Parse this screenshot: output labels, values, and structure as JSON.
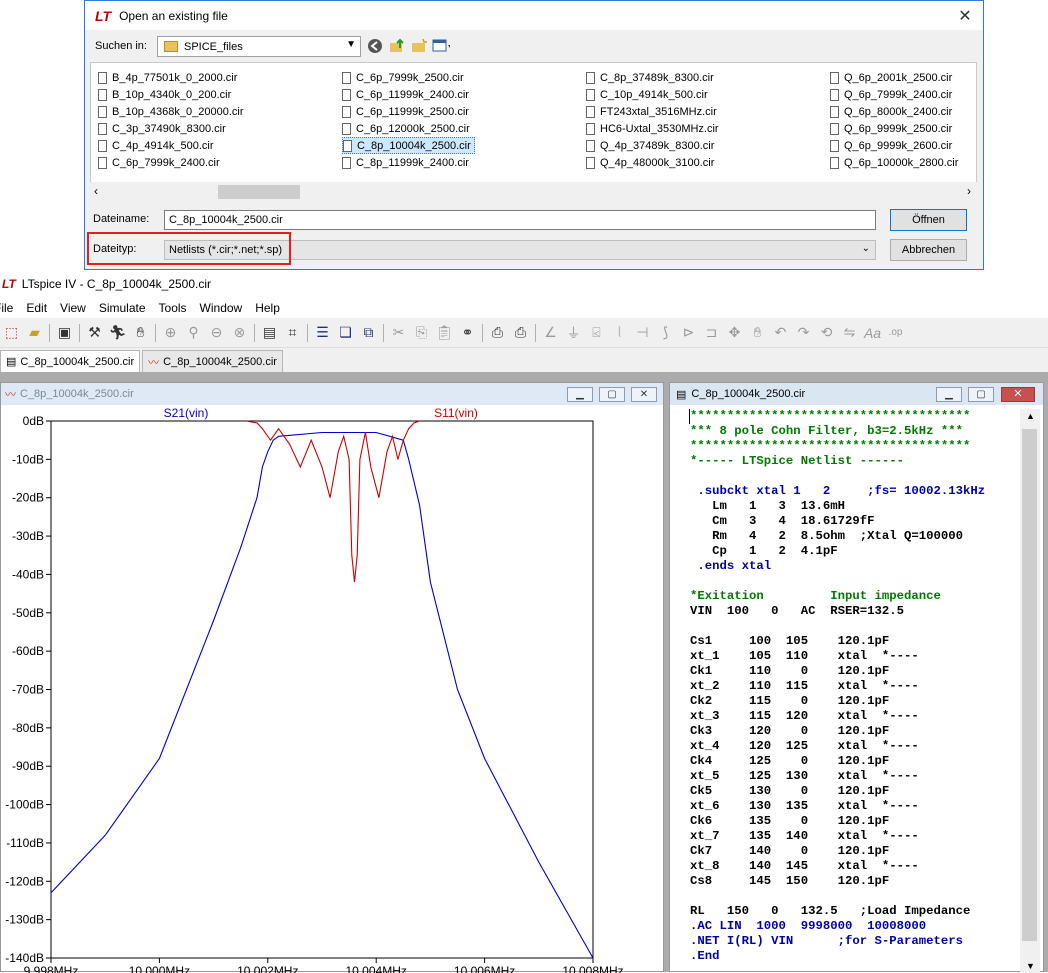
{
  "dialog": {
    "title": "Open an existing file",
    "look_in_label": "Suchen in:",
    "look_in_value": "SPICE_files",
    "columns": [
      [
        "B_4p_77501k_0_2000.cir",
        "B_10p_4340k_0_200.cir",
        "B_10p_4368k_0_20000.cir",
        "C_3p_37490k_8300.cir",
        "C_4p_4914k_500.cir",
        "C_6p_7999k_2400.cir"
      ],
      [
        "C_6p_7999k_2500.cir",
        "C_6p_11999k_2400.cir",
        "C_6p_11999k_2500.cir",
        "C_6p_12000k_2500.cir",
        "C_8p_10004k_2500.cir",
        "C_8p_11999k_2400.cir"
      ],
      [
        "C_8p_37489k_8300.cir",
        "C_10p_4914k_500.cir",
        "FT243xtal_3516MHz.cir",
        "HC6-Uxtal_3530MHz.cir",
        "Q_4p_37489k_8300.cir",
        "Q_4p_48000k_3100.cir"
      ],
      [
        "Q_6p_2001k_2500.cir",
        "Q_6p_7999k_2400.cir",
        "Q_6p_8000k_2400.cir",
        "Q_6p_9999k_2500.cir",
        "Q_6p_9999k_2600.cir",
        "Q_6p_10000k_2800.cir"
      ]
    ],
    "selected_file": "C_8p_10004k_2500.cir",
    "filename_label": "Dateiname:",
    "filename_value": "C_8p_10004k_2500.cir",
    "filetype_label": "Dateityp:",
    "filetype_value": "Netlists (*.cir;*.net;*.sp)",
    "open_button": "Öffnen",
    "cancel_button": "Abbrechen"
  },
  "ltspice": {
    "title": "LTspice IV - C_8p_10004k_2500.cir",
    "menu": [
      "File",
      "Edit",
      "View",
      "Simulate",
      "Tools",
      "Window",
      "Help"
    ],
    "tabs": [
      "C_8p_10004k_2500.cir",
      "C_8p_10004k_2500.cir"
    ],
    "plot_window_title": "C_8p_10004k_2500.cir",
    "netlist_window_title": "C_8p_10004k_2500.cir"
  },
  "chart_data": {
    "type": "line",
    "series": [
      {
        "name": "S21(vin)",
        "color": "#0000cc",
        "x": [
          9.998,
          9.999,
          10.0,
          10.001,
          10.0015,
          10.0018,
          10.0019,
          10.002,
          10.0021,
          10.0022,
          10.003,
          10.004,
          10.0045,
          10.0046,
          10.0048,
          10.005,
          10.0055,
          10.006,
          10.007,
          10.008
        ],
        "y": [
          -123,
          -108,
          -88,
          -52,
          -33,
          -20,
          -12,
          -8,
          -5,
          -4,
          -3,
          -3,
          -5,
          -10,
          -22,
          -42,
          -70,
          -88,
          -115,
          -140
        ]
      },
      {
        "name": "S11(vin)",
        "color": "#cc0000",
        "x": [
          10.0016,
          10.0018,
          10.0019,
          10.00205,
          10.0022,
          10.0024,
          10.0026,
          10.0028,
          10.003,
          10.00315,
          10.0033,
          10.0034,
          10.0035,
          10.00355,
          10.0036,
          10.00365,
          10.0037,
          10.0038,
          10.0039,
          10.00405,
          10.0042,
          10.0043,
          10.0044,
          10.0045,
          10.0046,
          10.0047,
          10.0048
        ],
        "y": [
          0,
          -0.5,
          -2,
          -5,
          -2,
          -6,
          -12,
          -5,
          -12,
          -20,
          -8,
          -4,
          -10,
          -35,
          -42,
          -35,
          -10,
          -3,
          -12,
          -20,
          -8,
          -4,
          -10,
          -5,
          -2,
          -0.5,
          0
        ]
      }
    ],
    "xlabels": [
      "9.998MHz",
      "10.000MHz",
      "10.002MHz",
      "10.004MHz",
      "10.006MHz",
      "10.008MHz"
    ],
    "xticks": [
      9.998,
      10.0,
      10.002,
      10.004,
      10.006,
      10.008
    ],
    "ylabels": [
      "0dB",
      "-10dB",
      "-20dB",
      "-30dB",
      "-40dB",
      "-50dB",
      "-60dB",
      "-70dB",
      "-80dB",
      "-90dB",
      "-100dB",
      "-110dB",
      "-120dB",
      "-130dB",
      "-140dB"
    ],
    "xlim": [
      9.998,
      10.008
    ],
    "ylim": [
      -140,
      0
    ],
    "grid": false,
    "legend": "top"
  },
  "netlist": [
    {
      "c": "g",
      "t": "**************************************"
    },
    {
      "c": "g",
      "t": "*** 8 pole Cohn Filter, b3=2.5kHz ***"
    },
    {
      "c": "g",
      "t": "**************************************"
    },
    {
      "c": "g",
      "t": "*----- LTSpice Netlist ------"
    },
    {
      "c": "k",
      "t": ""
    },
    {
      "c": "b",
      "t": " .subckt xtal 1   2     ;fs= 10002.13kHz"
    },
    {
      "c": "k",
      "t": "   Lm   1   3  13.6mH"
    },
    {
      "c": "k",
      "t": "   Cm   3   4  18.61729fF"
    },
    {
      "c": "k",
      "t": "   Rm   4   2  8.5ohm  ;Xtal Q=100000"
    },
    {
      "c": "k",
      "t": "   Cp   1   2  4.1pF"
    },
    {
      "c": "b",
      "t": " .ends xtal"
    },
    {
      "c": "k",
      "t": ""
    },
    {
      "c": "g",
      "t": "*Exitation         Input impedance"
    },
    {
      "c": "k",
      "t": "VIN  100   0   AC  RSER=132.5"
    },
    {
      "c": "k",
      "t": ""
    },
    {
      "c": "k",
      "t": "Cs1     100  105    120.1pF"
    },
    {
      "c": "k",
      "t": "xt_1    105  110    xtal  *----"
    },
    {
      "c": "k",
      "t": "Ck1     110    0    120.1pF"
    },
    {
      "c": "k",
      "t": "xt_2    110  115    xtal  *----"
    },
    {
      "c": "k",
      "t": "Ck2     115    0    120.1pF"
    },
    {
      "c": "k",
      "t": "xt_3    115  120    xtal  *----"
    },
    {
      "c": "k",
      "t": "Ck3     120    0    120.1pF"
    },
    {
      "c": "k",
      "t": "xt_4    120  125    xtal  *----"
    },
    {
      "c": "k",
      "t": "Ck4     125    0    120.1pF"
    },
    {
      "c": "k",
      "t": "xt_5    125  130    xtal  *----"
    },
    {
      "c": "k",
      "t": "Ck5     130    0    120.1pF"
    },
    {
      "c": "k",
      "t": "xt_6    130  135    xtal  *----"
    },
    {
      "c": "k",
      "t": "Ck6     135    0    120.1pF"
    },
    {
      "c": "k",
      "t": "xt_7    135  140    xtal  *----"
    },
    {
      "c": "k",
      "t": "Ck7     140    0    120.1pF"
    },
    {
      "c": "k",
      "t": "xt_8    140  145    xtal  *----"
    },
    {
      "c": "k",
      "t": "Cs8     145  150    120.1pF"
    },
    {
      "c": "k",
      "t": ""
    },
    {
      "c": "k",
      "t": "RL   150   0   132.5   ;Load Impedance"
    },
    {
      "c": "b",
      "t": ".AC LIN  1000  9998000  10008000"
    },
    {
      "c": "b",
      "t": ".NET I(RL) VIN      ;for S-Parameters"
    },
    {
      "c": "b",
      "t": ".End"
    }
  ]
}
